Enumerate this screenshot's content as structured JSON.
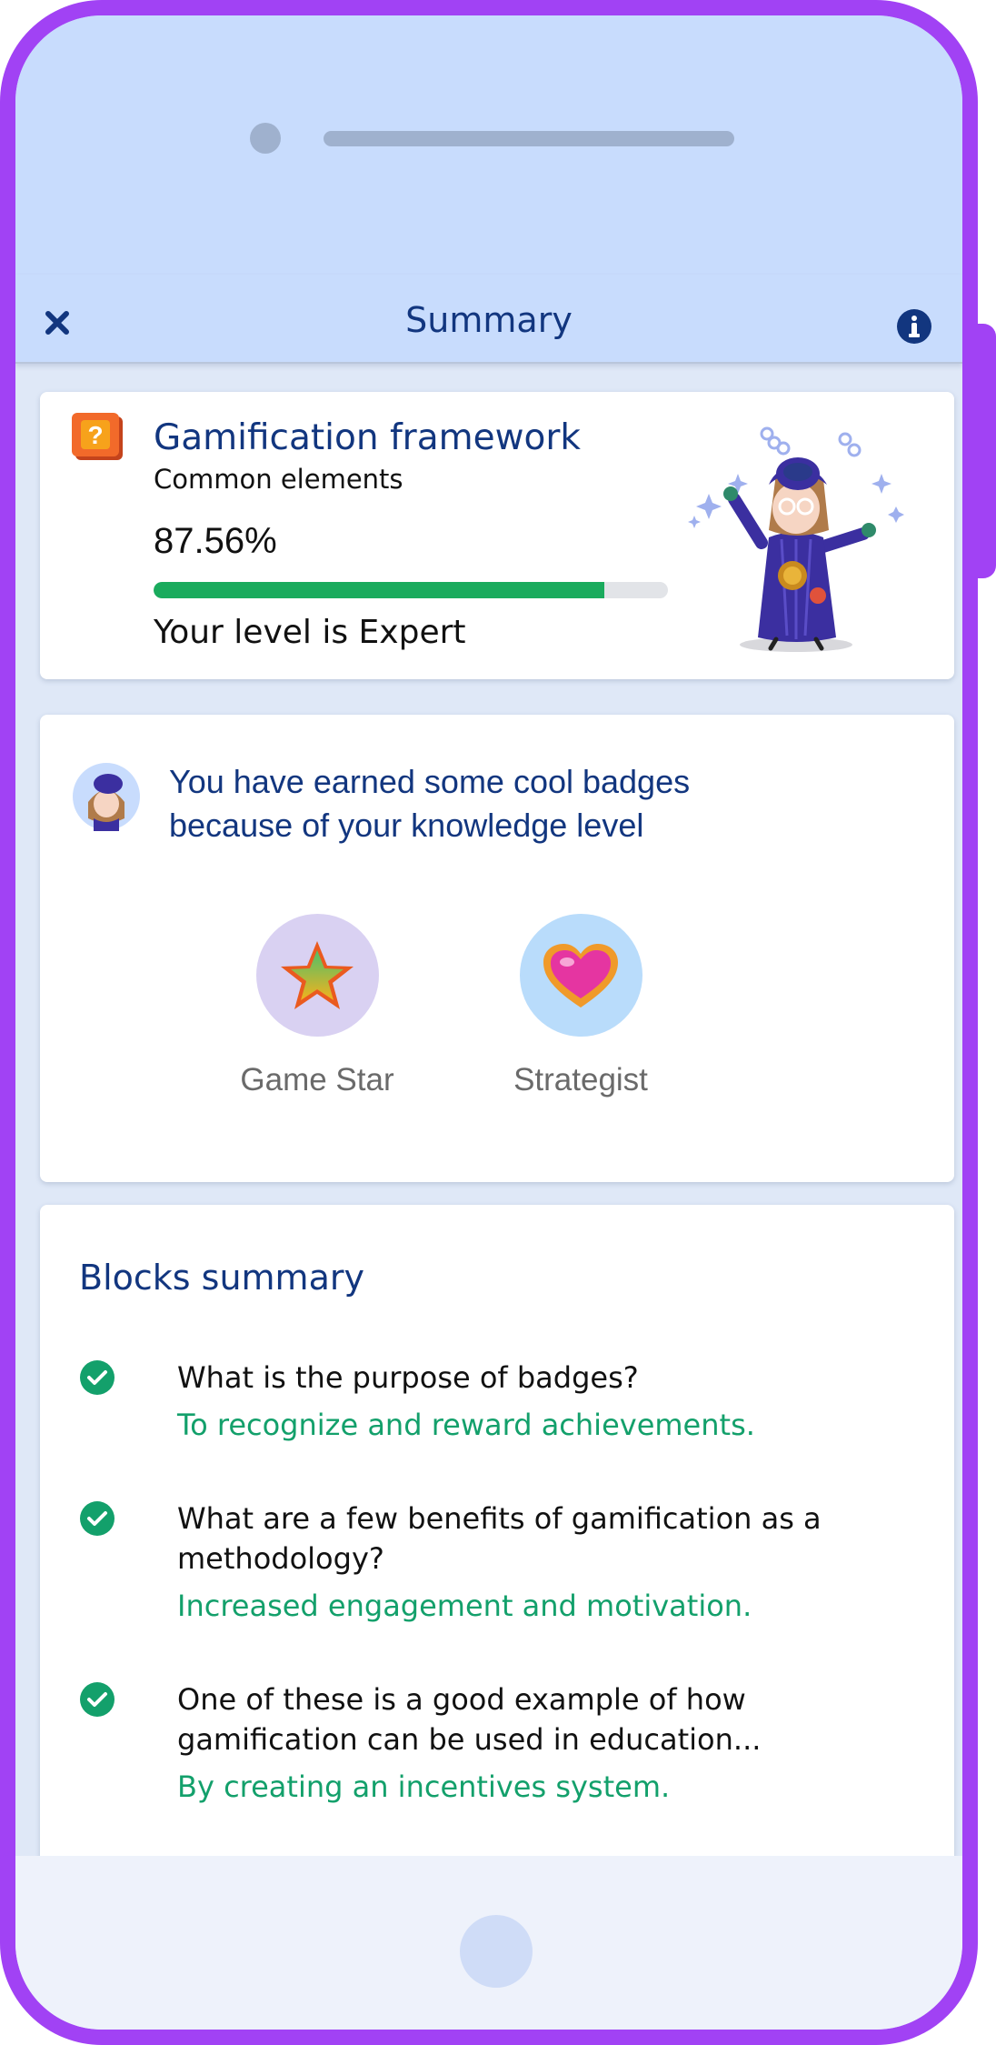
{
  "header": {
    "title": "Summary"
  },
  "framework": {
    "title": "Gamification framework",
    "subtitle": "Common elements",
    "score": "87.56%",
    "progress": 0.8756,
    "level": "Your level is Expert"
  },
  "badges": {
    "message": "You have earned some cool badges because of your knowledge level",
    "items": [
      {
        "label": "Game Star",
        "icon": "star-badge-icon"
      },
      {
        "label": "Strategist",
        "icon": "heart-badge-icon"
      }
    ]
  },
  "blocks": {
    "title": "Blocks summary",
    "items": [
      {
        "question": "What is the purpose of badges?",
        "answer": "To recognize and reward achievements."
      },
      {
        "question": "What are a few benefits of gamification as a methodology?",
        "answer": "Increased engagement and motivation."
      },
      {
        "question": "One of these is a good example of how gamification can be used in education...",
        "answer": "By creating an incentives system."
      }
    ]
  },
  "colors": {
    "frame": "#a142f4",
    "header_bg": "#c8dcfd",
    "title_blue": "#12367f",
    "progress_green": "#1aab5d",
    "answer_green": "#13a06b"
  }
}
